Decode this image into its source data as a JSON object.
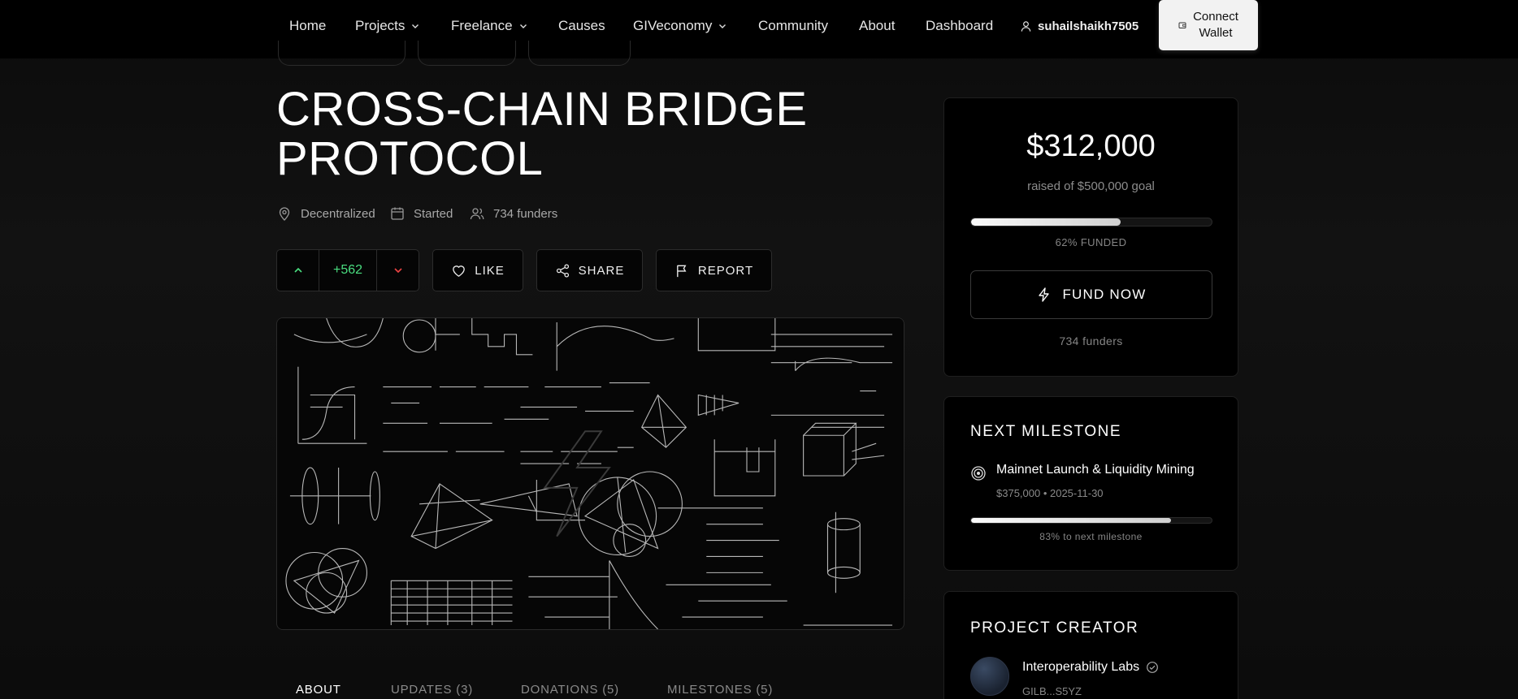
{
  "nav": {
    "home": "Home",
    "projects": "Projects",
    "freelance": "Freelance",
    "causes": "Causes",
    "giveconomy": "GIVeconomy",
    "community": "Community",
    "about": "About",
    "dashboard": "Dashboard",
    "username": "suhailshaikh7505",
    "connect_line1": "Connect",
    "connect_line2": "Wallet"
  },
  "project": {
    "title_line1": "CROSS-CHAIN BRIDGE",
    "title_line2": "PROTOCOL",
    "location": "Decentralized",
    "status": "Started",
    "funders": "734 funders"
  },
  "actions": {
    "vote_count": "+562",
    "like": "LIKE",
    "share": "SHARE",
    "report": "REPORT"
  },
  "tabs": [
    {
      "label": "ABOUT"
    },
    {
      "label": "UPDATES (3)"
    },
    {
      "label": "DONATIONS (5)"
    },
    {
      "label": "MILESTONES (5)"
    }
  ],
  "funding": {
    "raised": "$312,000",
    "goal_text": "raised of $500,000 goal",
    "progress": 0.62,
    "progress_label": "62% FUNDED",
    "fund_button": "FUND NOW",
    "funders": "734 funders"
  },
  "milestone": {
    "heading": "NEXT MILESTONE",
    "name": "Mainnet Launch & Liquidity Mining",
    "detail": "$375,000 • 2025-11-30",
    "progress": 0.83,
    "progress_label": "83% to next milestone"
  },
  "creator": {
    "heading": "PROJECT CREATOR",
    "name": "Interoperability Labs",
    "address": "GILB...S5YZ"
  },
  "colors": {
    "accent_green": "#4ade80",
    "accent_red": "#ef4444"
  }
}
